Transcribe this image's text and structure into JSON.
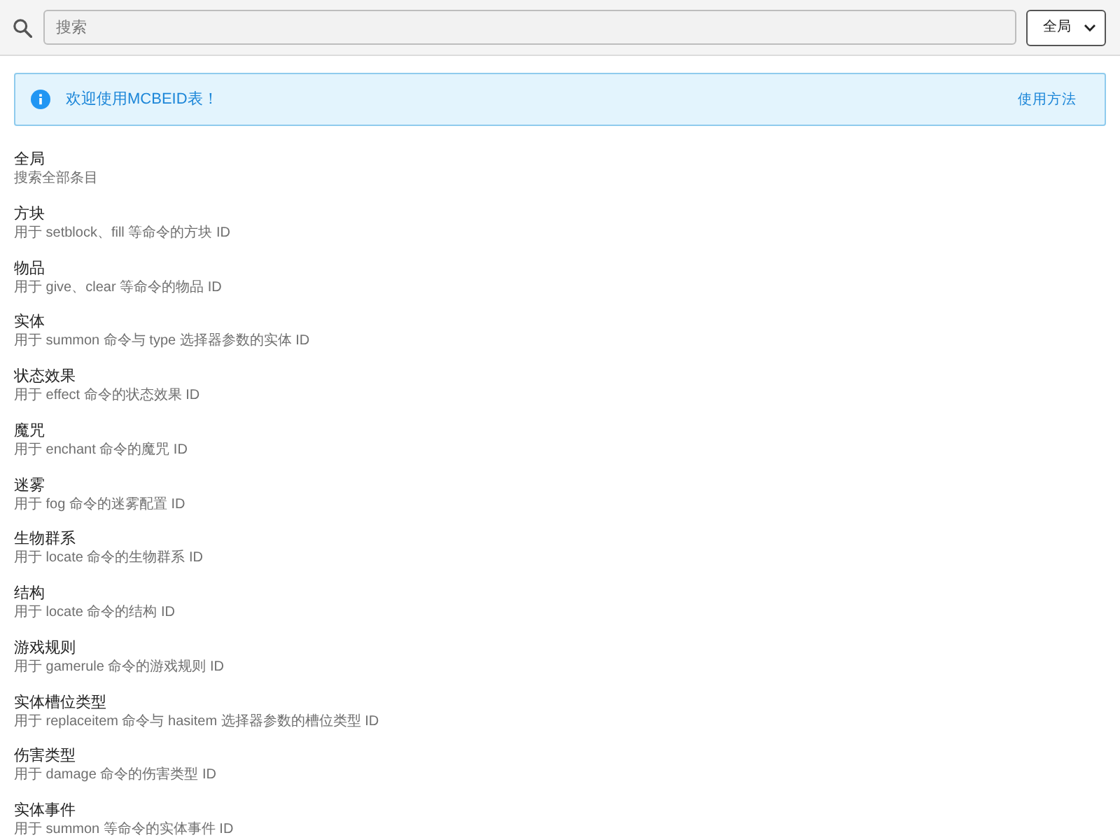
{
  "search": {
    "placeholder": "搜索"
  },
  "scope_dropdown": {
    "label": "全局"
  },
  "alert": {
    "message": "欢迎使用MCBEID表！",
    "link": "使用方法"
  },
  "categories": [
    {
      "title": "全局",
      "description": "搜索全部条目"
    },
    {
      "title": "方块",
      "description": "用于 setblock、fill 等命令的方块 ID"
    },
    {
      "title": "物品",
      "description": "用于 give、clear 等命令的物品 ID"
    },
    {
      "title": "实体",
      "description": "用于 summon 命令与 type 选择器参数的实体 ID"
    },
    {
      "title": "状态效果",
      "description": "用于 effect 命令的状态效果 ID"
    },
    {
      "title": "魔咒",
      "description": "用于 enchant 命令的魔咒 ID"
    },
    {
      "title": "迷雾",
      "description": "用于 fog 命令的迷雾配置 ID"
    },
    {
      "title": "生物群系",
      "description": "用于 locate 命令的生物群系 ID"
    },
    {
      "title": "结构",
      "description": "用于 locate 命令的结构 ID"
    },
    {
      "title": "游戏规则",
      "description": "用于 gamerule 命令的游戏规则 ID"
    },
    {
      "title": "实体槽位类型",
      "description": "用于 replaceitem 命令与 hasitem 选择器参数的槽位类型 ID"
    },
    {
      "title": "伤害类型",
      "description": "用于 damage 命令的伤害类型 ID"
    },
    {
      "title": "实体事件",
      "description": "用于 summon 等命令的实体事件 ID"
    }
  ]
}
